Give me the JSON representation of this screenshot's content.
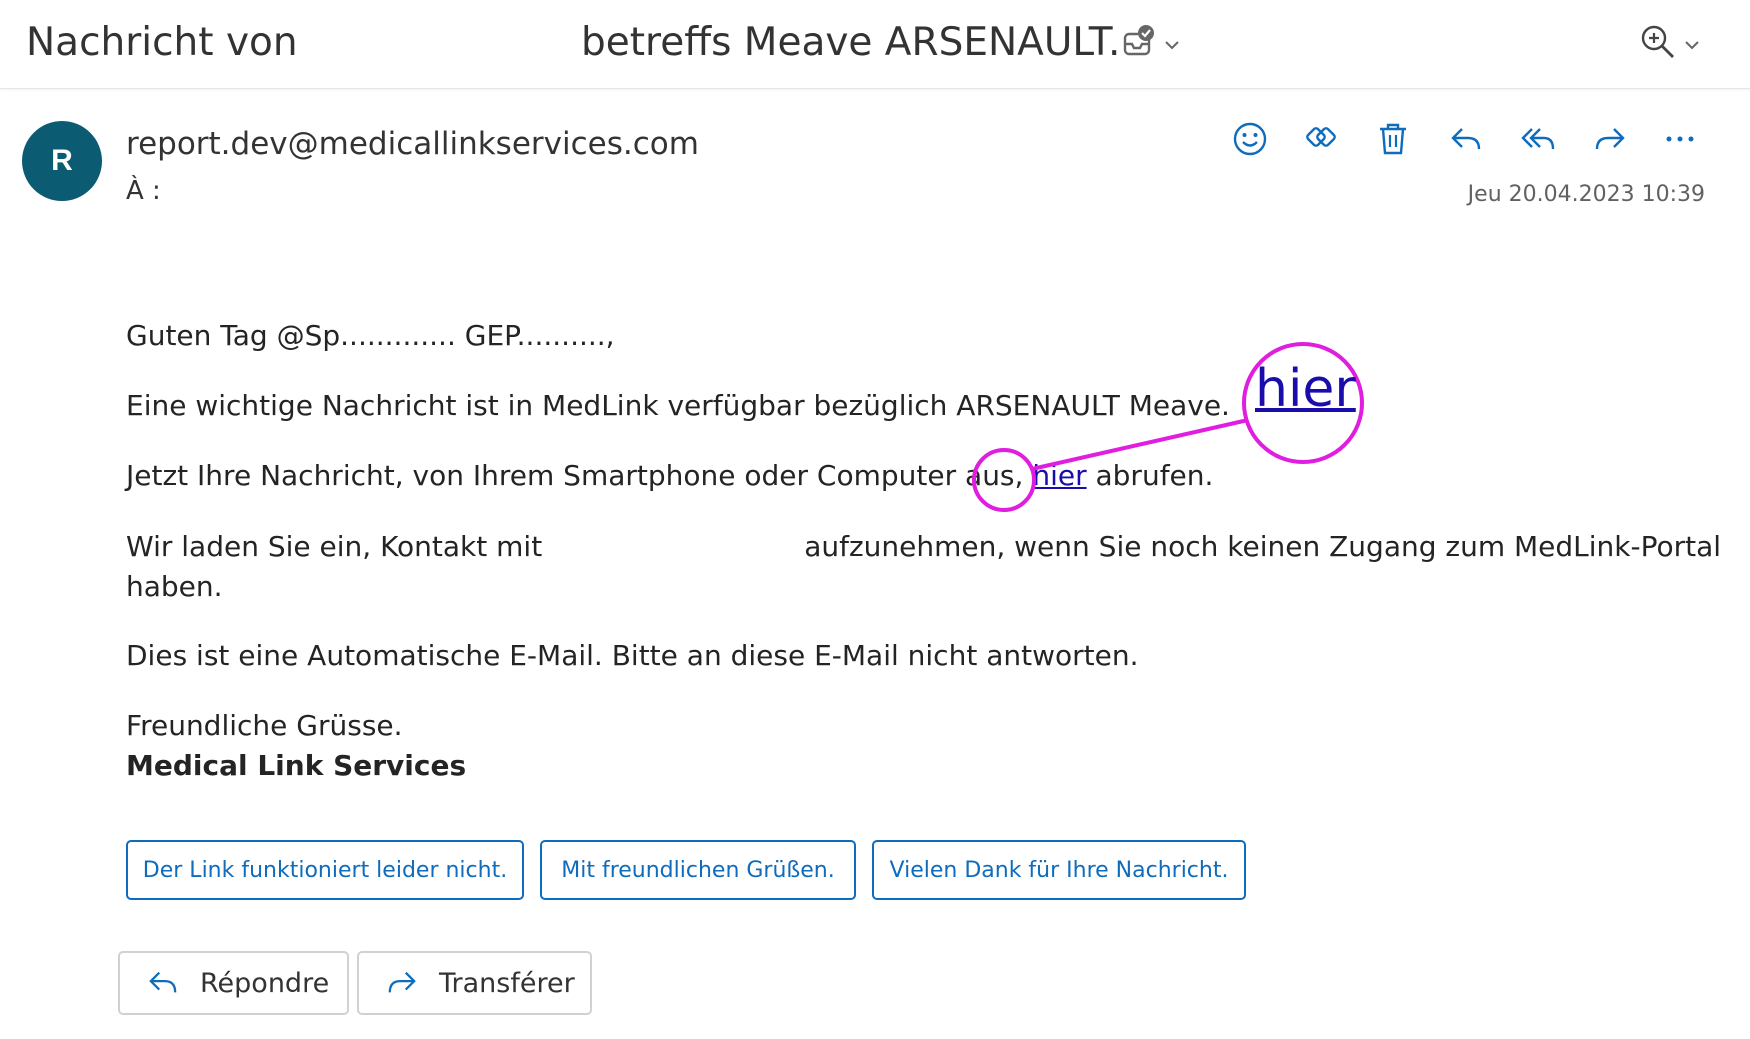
{
  "subject": {
    "left": "Nachricht von",
    "right": "betreffs Meave ARSENAULT."
  },
  "header": {
    "avatar_initial": "R",
    "sender": "report.dev@medicallinkservices.com",
    "to_label": "À :",
    "date": "Jeu 20.04.2023 10:39"
  },
  "body": {
    "greeting": "Guten Tag @Sp............. GEP..........,",
    "line1": "Eine wichtige Nachricht ist in MedLink verfügbar bezüglich ARSENAULT Meave.",
    "line2_before": "Jetzt Ihre Nachricht, von Ihrem Smartphone oder Computer aus,",
    "line2_link": "hier",
    "line2_after": "abrufen.",
    "line3_start": "Wir laden Sie ein, Kontakt mit",
    "line3_end": "aufzunehmen, wenn Sie noch keinen Zugang zum MedLink-Portal",
    "line3_cont": "haben.",
    "line4": "Dies ist eine Automatische E-Mail. Bitte an diese E-Mail nicht antworten.",
    "line5": "Freundliche Grüsse.",
    "signature": "Medical Link Services"
  },
  "annotation": {
    "zoom_text": "hier",
    "color": "#e01ee0"
  },
  "quick_replies": [
    "Der Link funktioniert leider nicht.",
    "Mit freundlichen Grüßen.",
    "Vielen Dank für Ihre Nachricht."
  ],
  "buttons": {
    "reply": "Répondre",
    "forward": "Transférer"
  },
  "colors": {
    "accent": "#0f6cbd",
    "avatar": "#0b5c73",
    "link": "#1a0dab"
  }
}
